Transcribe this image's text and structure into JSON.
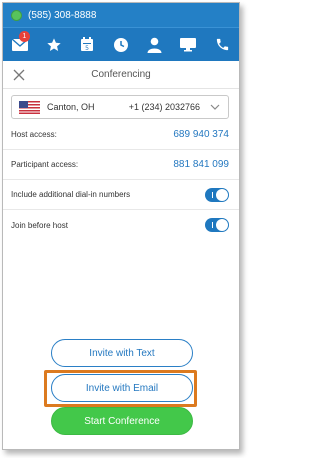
{
  "status_bar": {
    "phone_number": "(585) 308-8888",
    "status_color": "#58c35c"
  },
  "nav": {
    "messages_badge": "1",
    "icons": [
      "mail-icon",
      "star-icon",
      "calendar-icon",
      "clock-icon",
      "person-icon",
      "monitor-icon",
      "phone-icon"
    ],
    "accent_color": "#1f78bf"
  },
  "header": {
    "title": "Conferencing"
  },
  "location": {
    "city": "Canton, OH",
    "phone": "+1 (234) 2032766"
  },
  "rows": {
    "host_access": {
      "label": "Host access:",
      "value": "689 940 374"
    },
    "participant_access": {
      "label": "Participant access:",
      "value": "881 841 099"
    },
    "dial_in": {
      "label": "Include additional dial-in numbers",
      "enabled": true
    },
    "join_before_host": {
      "label": "Join before host",
      "enabled": true
    }
  },
  "buttons": {
    "invite_text": "Invite with Text",
    "invite_email": "Invite with Email",
    "start_conference": "Start Conference"
  },
  "colors": {
    "highlight": "#dc7a1f",
    "start_button": "#43c84a",
    "link": "#2478c0"
  }
}
